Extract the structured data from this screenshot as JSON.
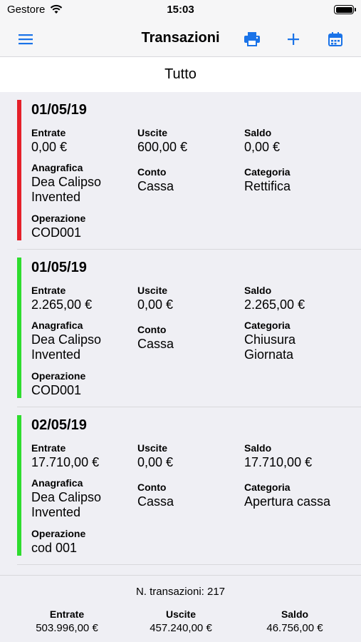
{
  "status_bar": {
    "carrier": "Gestore",
    "time": "15:03"
  },
  "nav": {
    "title": "Transazioni"
  },
  "filter": {
    "label": "Tutto"
  },
  "colors": {
    "accent": "#1a73e8",
    "negative": "#e5202a",
    "positive": "#2edc2e"
  },
  "transactions": [
    {
      "date": "01/05/19",
      "entrate_label": "Entrate",
      "entrate": "0,00 €",
      "uscite_label": "Uscite",
      "uscite": "600,00 €",
      "saldo_label": "Saldo",
      "saldo": "0,00 €",
      "anagrafica_label": "Anagrafica",
      "anagrafica": [
        "Dea Calipso",
        "Invented"
      ],
      "conto_label": "Conto",
      "conto": "Cassa",
      "categoria_label": "Categoria",
      "categoria": [
        "Rettifica"
      ],
      "operazione_label": "Operazione",
      "operazione": "COD001",
      "status": "negative"
    },
    {
      "date": "01/05/19",
      "entrate_label": "Entrate",
      "entrate": "2.265,00 €",
      "uscite_label": "Uscite",
      "uscite": "0,00 €",
      "saldo_label": "Saldo",
      "saldo": "2.265,00 €",
      "anagrafica_label": "Anagrafica",
      "anagrafica": [
        "Dea Calipso",
        "Invented"
      ],
      "conto_label": "Conto",
      "conto": "Cassa",
      "categoria_label": "Categoria",
      "categoria": [
        "Chiusura",
        "Giornata"
      ],
      "operazione_label": "Operazione",
      "operazione": "COD001",
      "status": "positive"
    },
    {
      "date": "02/05/19",
      "entrate_label": "Entrate",
      "entrate": "17.710,00 €",
      "uscite_label": "Uscite",
      "uscite": "0,00 €",
      "saldo_label": "Saldo",
      "saldo": "17.710,00 €",
      "anagrafica_label": "Anagrafica",
      "anagrafica": [
        "Dea Calipso",
        "Invented"
      ],
      "conto_label": "Conto",
      "conto": "Cassa",
      "categoria_label": "Categoria",
      "categoria": [
        "Apertura cassa"
      ],
      "operazione_label": "Operazione",
      "operazione": "cod 001",
      "status": "positive"
    }
  ],
  "summary": {
    "count_text": "N. transazioni: 217",
    "entrate_label": "Entrate",
    "entrate": "503.996,00 €",
    "uscite_label": "Uscite",
    "uscite": "457.240,00 €",
    "saldo_label": "Saldo",
    "saldo": "46.756,00 €"
  }
}
